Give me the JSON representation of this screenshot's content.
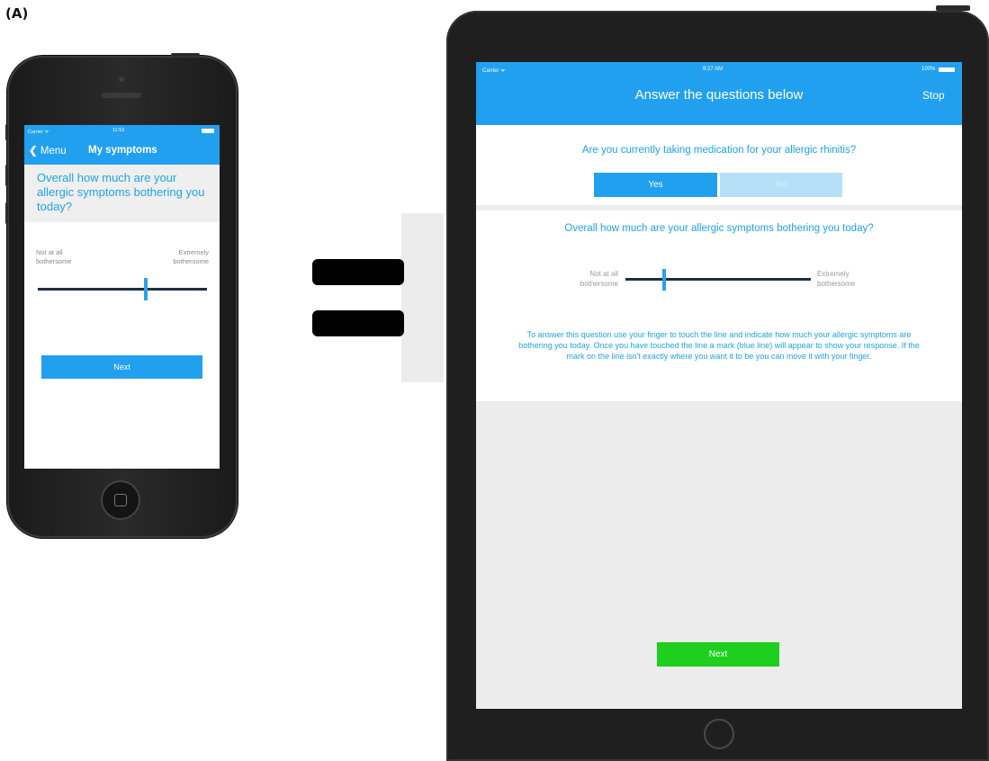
{
  "figure_label": "(A)",
  "phone": {
    "status": {
      "carrier": "Carrier ᯤ",
      "time": "11:53"
    },
    "nav": {
      "back_label": "Menu",
      "title": "My symptoms"
    },
    "question": "Overall how much are your allergic symptoms bothering you today?",
    "scale_left": "Not at all bothersome",
    "scale_right": "Extremely bothersome",
    "slider_value": 0.64,
    "next_label": "Next"
  },
  "tablet": {
    "status": {
      "carrier": "Carrier ᯤ",
      "time": "8:27 AM",
      "battery": "100%"
    },
    "header": {
      "title": "Answer the questions below",
      "stop_label": "Stop"
    },
    "question1": "Are you currently taking medication for your allergic rhinitis?",
    "yes_label": "Yes",
    "no_label": "No",
    "question2": "Overall how much are your allergic symptoms bothering you today?",
    "scale_left": "Not at all bothersome",
    "scale_right": "Extremely bothersome",
    "slider_value": 0.21,
    "instructions": "To answer this question use your finger to touch the line and indicate how much your allergic symptoms are bothering you today. Once you have touched the line a mark (blue line) will appear to show your response. If the mark on the line isn't exactly where you want it to be you can move it with your finger.",
    "next_label": "Next"
  },
  "colors": {
    "accent_blue": "#22a0f0",
    "next_green": "#1ecf1e",
    "disabled_blue": "#b6e0f8"
  }
}
